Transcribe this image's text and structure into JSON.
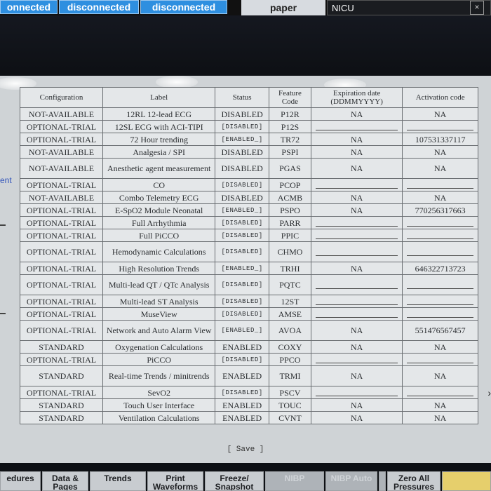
{
  "topbar": {
    "buttons": [
      "onnected",
      "disconnected",
      "disconnected"
    ],
    "paper": "paper",
    "unit": "NICU",
    "close_glyph": "×"
  },
  "side_label": "ent",
  "table": {
    "headers": [
      "Configuration",
      "Label",
      "Status",
      "Feature Code",
      "Expiration date (DDMMYYYY)",
      "Activation code"
    ],
    "rows": [
      [
        "NOT-AVAILABLE",
        "12RL 12-lead ECG",
        "DISABLED",
        "P12R",
        "NA",
        "NA"
      ],
      [
        "OPTIONAL-TRIAL",
        "12SL ECG with ACI-TIPI",
        "[DISABLED]",
        "P12S",
        "",
        ""
      ],
      [
        "OPTIONAL-TRIAL",
        "72 Hour trending",
        "[ENABLED_]",
        "TR72",
        "NA",
        "107531337117"
      ],
      [
        "NOT-AVAILABLE",
        "Analgesia / SPI",
        "DISABLED",
        "PSPI",
        "NA",
        "NA"
      ],
      [
        "NOT-AVAILABLE",
        "Anesthetic agent measurement",
        "DISABLED",
        "PGAS",
        "NA",
        "NA"
      ],
      [
        "OPTIONAL-TRIAL",
        "CO",
        "[DISABLED]",
        "PCOP",
        "",
        ""
      ],
      [
        "NOT-AVAILABLE",
        "Combo Telemetry ECG",
        "DISABLED",
        "ACMB",
        "NA",
        "NA"
      ],
      [
        "OPTIONAL-TRIAL",
        "E-SpO2 Module Neonatal",
        "[ENABLED_]",
        "PSPO",
        "NA",
        "770256317663"
      ],
      [
        "OPTIONAL-TRIAL",
        "Full Arrhythmia",
        "[DISABLED]",
        "PARR",
        "",
        ""
      ],
      [
        "OPTIONAL-TRIAL",
        "Full PiCCO",
        "[DISABLED]",
        "PPIC",
        "",
        ""
      ],
      [
        "OPTIONAL-TRIAL",
        "Hemodynamic Calculations",
        "[DISABLED]",
        "CHMO",
        "",
        ""
      ],
      [
        "OPTIONAL-TRIAL",
        "High Resolution Trends",
        "[ENABLED_]",
        "TRHI",
        "NA",
        "646322713723"
      ],
      [
        "OPTIONAL-TRIAL",
        "Multi-lead QT / QTc Analysis",
        "[DISABLED]",
        "PQTC",
        "",
        ""
      ],
      [
        "OPTIONAL-TRIAL",
        "Multi-lead ST Analysis",
        "[DISABLED]",
        "12ST",
        "",
        ""
      ],
      [
        "OPTIONAL-TRIAL",
        "MuseView",
        "[DISABLED]",
        "AMSE",
        "",
        ""
      ],
      [
        "OPTIONAL-TRIAL",
        "Network and Auto Alarm View",
        "[ENABLED_]",
        "AVOA",
        "NA",
        "551476567457"
      ],
      [
        "STANDARD",
        "Oxygenation Calculations",
        "ENABLED",
        "COXY",
        "NA",
        "NA"
      ],
      [
        "OPTIONAL-TRIAL",
        "PiCCO",
        "[DISABLED]",
        "PPCO",
        "",
        ""
      ],
      [
        "STANDARD",
        "Real-time Trends / minitrends",
        "ENABLED",
        "TRMI",
        "NA",
        "NA"
      ],
      [
        "OPTIONAL-TRIAL",
        "SevO2",
        "[DISABLED]",
        "PSCV",
        "",
        ""
      ],
      [
        "STANDARD",
        "Touch User Interface",
        "ENABLED",
        "TOUC",
        "NA",
        "NA"
      ],
      [
        "STANDARD",
        "Ventilation Calculations",
        "ENABLED",
        "CVNT",
        "NA",
        "NA"
      ]
    ],
    "tall_rows": [
      4,
      10,
      12,
      15,
      18
    ]
  },
  "save_label": "[ Save ]",
  "bottombar": {
    "buttons": [
      {
        "label": "edures",
        "style": "normal"
      },
      {
        "label": "Data & Pages",
        "style": "normal"
      },
      {
        "label": "Trends",
        "style": "normal"
      },
      {
        "label": "Print Waveforms",
        "style": "normal"
      },
      {
        "label": "Freeze/ Snapshot",
        "style": "normal"
      },
      {
        "label": "NIBP",
        "style": "dim"
      },
      {
        "label": "NIBP Auto",
        "style": "dim"
      },
      {
        "label": "",
        "style": "dim"
      },
      {
        "label": "Zero All Pressures",
        "style": "normal"
      },
      {
        "label": "",
        "style": "yellow"
      }
    ]
  }
}
